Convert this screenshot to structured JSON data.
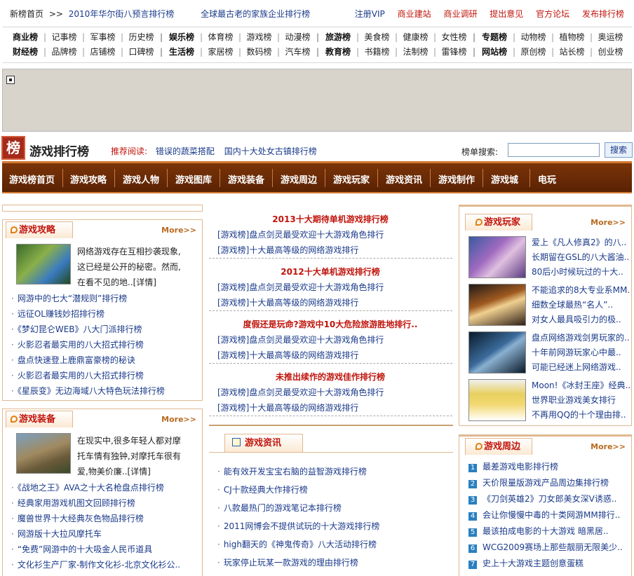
{
  "topbar": {
    "home": "新榜首页",
    "arrow": ">>",
    "link1": "2010年华尔街八预言排行榜",
    "link2": "全球最古老的家族企业排行榜",
    "right": [
      "注册VIP",
      "商业建站",
      "商业调研",
      "提出意见",
      "官方论坛",
      "发布排行榜"
    ]
  },
  "catgrid": {
    "row1": [
      "商业榜",
      "记事榜",
      "军事榜",
      "历史榜",
      "娱乐榜",
      "体育榜",
      "游戏榜",
      "动漫榜",
      "旅游榜",
      "美食榜",
      "健康榜",
      "女性榜",
      "专题榜",
      "动物榜",
      "植物榜",
      "奥运榜"
    ],
    "row2": [
      "财经榜",
      "品牌榜",
      "店铺榜",
      "口碑榜",
      "生活榜",
      "家居榜",
      "数码榜",
      "汽车榜",
      "教育榜",
      "书籍榜",
      "法制榜",
      "雷锋榜",
      "网站榜",
      "原创榜",
      "站长榜",
      "创业榜"
    ]
  },
  "header": {
    "logo_char": "榜",
    "title": "游戏排行榜",
    "rec_label": "推荐阅读:",
    "rec1": "错误的蔬菜搭配",
    "rec2": "国内十大处女古镇排行榜",
    "search_label": "榜单搜索:",
    "search_value": "",
    "search_btn": "搜索"
  },
  "nav": [
    "游戏榜首页",
    "游戏攻略",
    "游戏人物",
    "游戏图库",
    "游戏装备",
    "游戏周边",
    "游戏玩家",
    "游戏资讯",
    "游戏制作",
    "游戏城",
    "电玩"
  ],
  "left1": {
    "tab": "游戏攻略",
    "more": "More>>",
    "intro": [
      "网络游戏存在互相抄袭现象,",
      "这已经是公开的秘密。然而,",
      "在看不见的地..[详情]"
    ],
    "list": [
      "网游中的七大“潜规则”排行榜",
      "远征OL赚钱妙招排行榜",
      "《梦幻昆仑WEB》八大门派排行榜",
      "火影忍者最实用的八大招式排行榜",
      "盘点快速登上鹿鼎富豪榜的秘诀",
      "火影忍者最实用的八大招式排行榜",
      "《星辰变》无边海域八大特色玩法排行榜"
    ]
  },
  "left2": {
    "tab": "游戏装备",
    "more": "More>>",
    "intro": [
      "在现实中,很多年轻人都对摩",
      "托车情有独钟,对摩托车很有",
      "爱,物美价廉..[详情]"
    ],
    "list": [
      "《战地之王》AVA之十大名枪盘点排行榜",
      "经典家用游戏机图文回顾排行榜",
      "魔兽世界十大经典灰色物品排行榜",
      "网游版十大拉风摩托车",
      "“免费”网游中的十大吸金人民币道具",
      "文化衫生产厂家-制作文化衫-北京文化衫公.."
    ]
  },
  "middle": {
    "sections": [
      {
        "title": "2013十大期待单机游戏排行榜",
        "links": [
          "[游戏榜]盘点剑灵最受欢迎十大游戏角色排行",
          "[游戏榜]十大最高等级的网络游戏排行"
        ]
      },
      {
        "title": "2012十大单机游戏排行榜",
        "links": [
          "[游戏榜]盘点剑灵最受欢迎十大游戏角色排行",
          "[游戏榜]十大最高等级的网络游戏排行"
        ]
      },
      {
        "title": "度假还是玩命?游戏中10大危险旅游胜地排行..",
        "links": [
          "[游戏榜]盘点剑灵最受欢迎十大游戏角色排行",
          "[游戏榜]十大最高等级的网络游戏排行"
        ]
      },
      {
        "title": "未推出续作的游戏佳作排行榜",
        "links": [
          "[游戏榜]盘点剑灵最受欢迎十大游戏角色排行",
          "[游戏榜]十大最高等级的网络游戏排行"
        ]
      }
    ],
    "news_tab": "游戏资讯",
    "news": [
      "能有效开发宝宝右脑的益智游戏排行榜",
      "CJ十款经典大作排行榜",
      "八款最热门的游戏笔记本排行榜",
      "2011网博会不提供试玩的十大游戏排行榜",
      "high翻天的《神鬼传奇》八大活动排行榜",
      "玩家停止玩某一款游戏的理由排行榜"
    ]
  },
  "right1": {
    "tab": "游戏玩家",
    "more": "More>>",
    "items": [
      [
        "爱上《凡人修真2》的八..",
        "长期留在GSL的八大酱油..",
        "80后小时候玩过的十大.."
      ],
      [
        "不能追求的8大专业系MM..",
        "细数全球最热“名人”..",
        "对女人最具吸引力的极.."
      ],
      [
        "盘点网络游戏剑男玩家的..",
        "十年前网游玩家心中最..",
        "可能已经迷上网络游戏.."
      ],
      [
        "Moon!《冰封王座》经典..",
        "世界职业游戏美女排行",
        "不再用QQ的十个理由排.."
      ]
    ]
  },
  "right2": {
    "tab": "游戏周边",
    "more": "More>>",
    "list": [
      "最差游戏电影排行榜",
      "天价限量版游戏产品周边集排行榜",
      "《刀剑英雄2》刀女郎美女深V诱惑..",
      "会让你慢慢中毒的十类网游MM排行..",
      "最该拍成电影的十大游戏 暗黑居..",
      "WCG2009赛场上那些靓丽无限美少..",
      "史上十大游戏主题创意蛋糕"
    ]
  }
}
